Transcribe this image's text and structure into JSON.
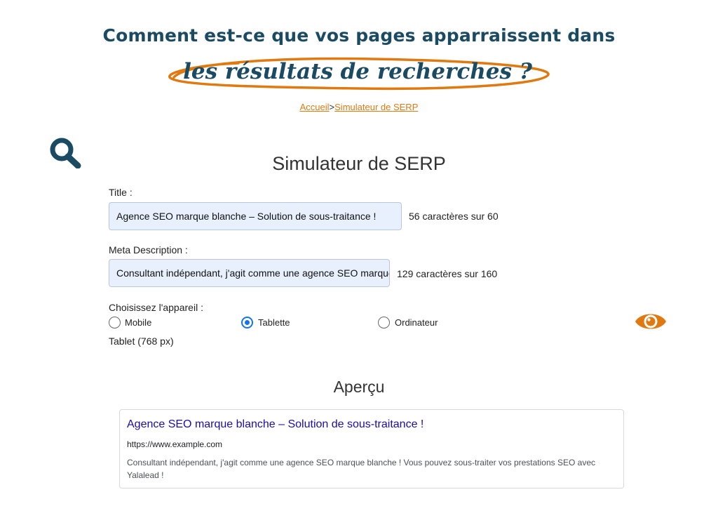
{
  "hero": {
    "line1": "Comment est-ce que vos pages apparraissent dans",
    "line2": "les résultats de recherches ?"
  },
  "breadcrumb": {
    "home": "Accueil",
    "separator": ">",
    "current": "Simulateur de SERP"
  },
  "main": {
    "heading": "Simulateur de SERP",
    "title_label": "Title :",
    "title_value": "Agence SEO marque blanche – Solution de sous-traitance !",
    "title_count": "56 caractères sur 60",
    "meta_label": "Meta Description :",
    "meta_value": "Consultant indépendant, j'agit comme une agence SEO marque blanche ! Vous pouvez sous-traiter vos prestations SEO avec Yalalead !",
    "meta_count": "129 caractères sur 160",
    "device_label": "Choisissez l'appareil :",
    "devices": [
      {
        "label": "Mobile",
        "checked": false
      },
      {
        "label": "Tablette",
        "checked": true
      },
      {
        "label": "Ordinateur",
        "checked": false
      }
    ],
    "device_info": "Tablet (768 px)"
  },
  "preview": {
    "heading": "Aperçu",
    "title": "Agence SEO marque blanche – Solution de sous-traitance !",
    "url": "https://www.example.com",
    "description": "Consultant indépendant, j'agit comme une agence SEO marque blanche ! Vous pouvez sous-traiter vos prestations SEO avec Yalalead !"
  },
  "icons": {
    "search": "search-icon",
    "eye": "eye-icon"
  },
  "colors": {
    "navy": "#1b4a63",
    "orange": "#e07a10",
    "field_bg": "#e8f0fe",
    "link_blue": "#1a0dab",
    "radio_blue": "#1a73e8"
  }
}
